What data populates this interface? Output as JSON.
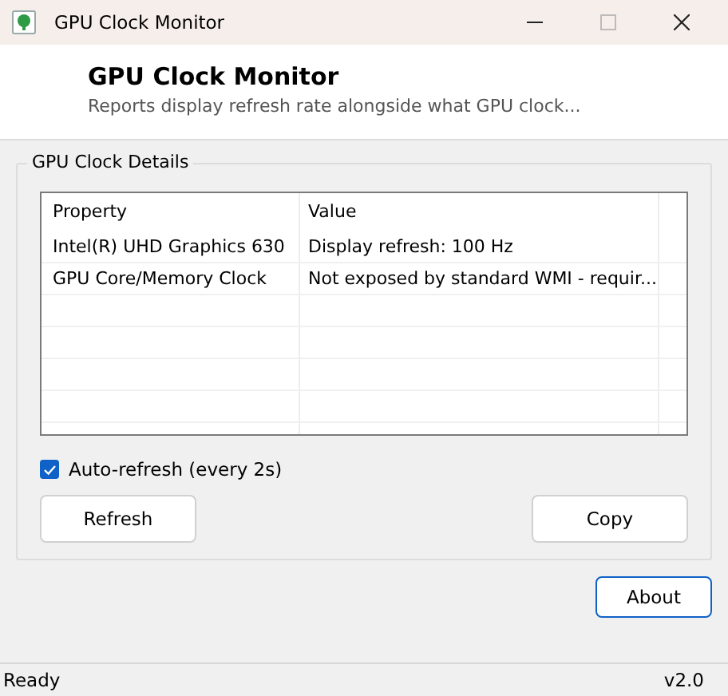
{
  "window": {
    "title": "GPU Clock Monitor"
  },
  "header": {
    "title": "GPU Clock Monitor",
    "subtitle": "Reports display refresh rate alongside what GPU clock..."
  },
  "group": {
    "title": "GPU Clock Details"
  },
  "table": {
    "columns": [
      "Property",
      "Value"
    ],
    "rows": [
      [
        "Intel(R) UHD Graphics 630",
        "Display refresh: 100 Hz"
      ],
      [
        "GPU Core/Memory Clock",
        "Not exposed by standard WMI - requir..."
      ]
    ]
  },
  "auto_refresh": {
    "label": "Auto-refresh (every 2s)",
    "checked": true
  },
  "buttons": [
    "Refresh",
    "Copy"
  ],
  "about_button": "About",
  "status_bar": {
    "status": "Ready",
    "version": "v2.0"
  }
}
